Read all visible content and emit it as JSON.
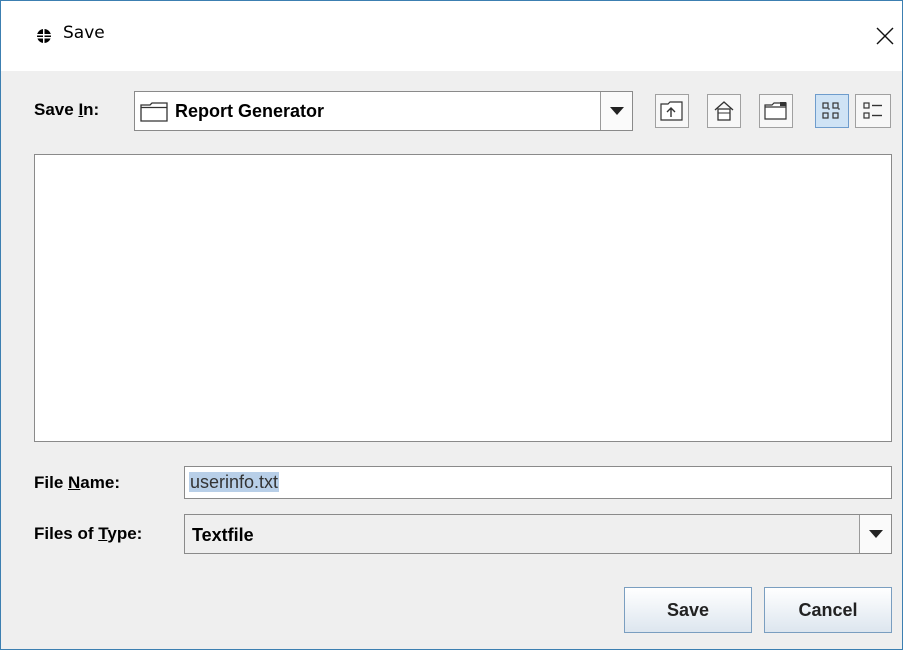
{
  "window": {
    "title": "Save"
  },
  "save_in": {
    "label_pre": "Save ",
    "label_mnemonic": "I",
    "label_post": "n:",
    "value": "Report Generator"
  },
  "toolbar": {
    "icons": [
      "up-one-level-icon",
      "home-icon",
      "new-folder-icon",
      "list-view-icon",
      "details-view-icon"
    ]
  },
  "file_name": {
    "label_pre": "File ",
    "label_mnemonic": "N",
    "label_post": "ame:",
    "value": "userinfo.txt"
  },
  "file_type": {
    "label_pre": "Files of ",
    "label_mnemonic": "T",
    "label_post": "ype:",
    "value": "Textfile"
  },
  "buttons": {
    "save": "Save",
    "cancel": "Cancel"
  }
}
